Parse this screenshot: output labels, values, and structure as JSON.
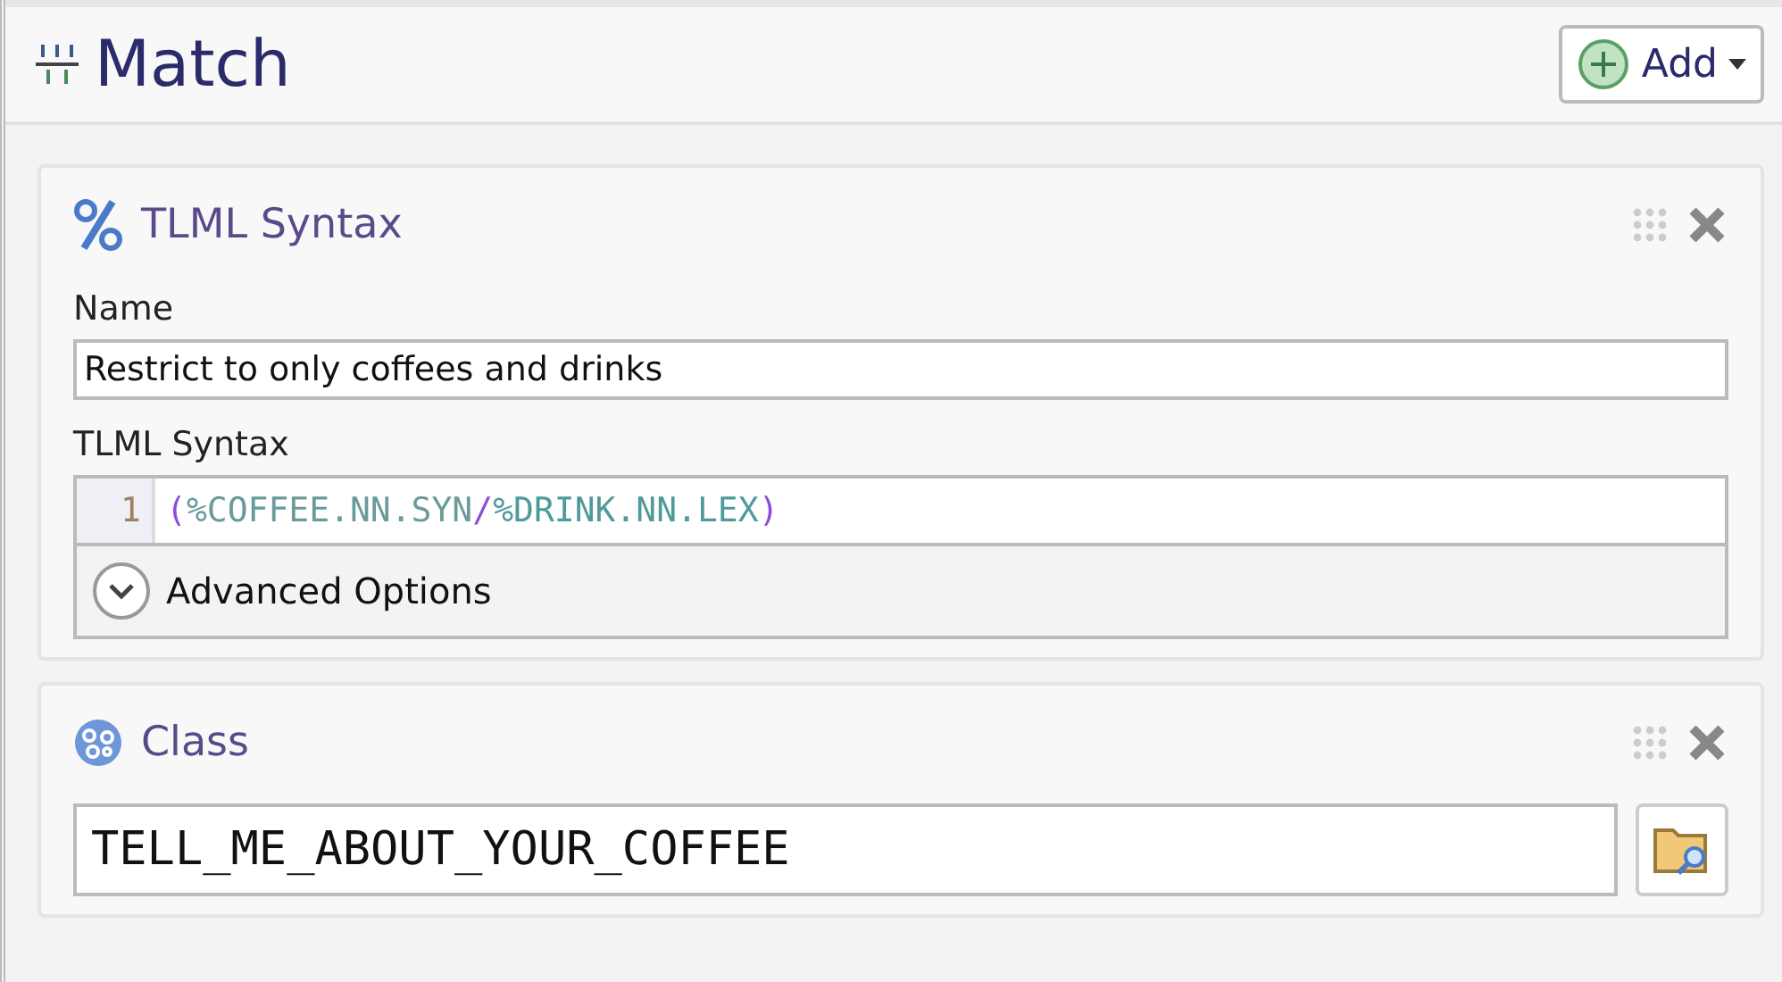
{
  "header": {
    "title": "Match",
    "add_button": "Add"
  },
  "cards": [
    {
      "kind": "syntax",
      "title": "TLML Syntax",
      "name_label": "Name",
      "name_value": "Restrict to only coffees and drinks",
      "syntax_label": "TLML Syntax",
      "line_number": "1",
      "tokens": [
        {
          "text": "(",
          "color": "#8a4fd8"
        },
        {
          "text": "%COFFEE.NN.SYN",
          "color": "#6a9a9a"
        },
        {
          "text": "/",
          "color": "#8a4fd8"
        },
        {
          "text": "%DRINK.NN.LEX",
          "color": "#4f9a9a"
        },
        {
          "text": ")",
          "color": "#8a4fd8"
        }
      ],
      "advanced": {
        "label": "Advanced Options",
        "expanded": false
      }
    },
    {
      "kind": "class",
      "title": "Class",
      "value": "TELL_ME_ABOUT_YOUR_COFFEE"
    }
  ]
}
